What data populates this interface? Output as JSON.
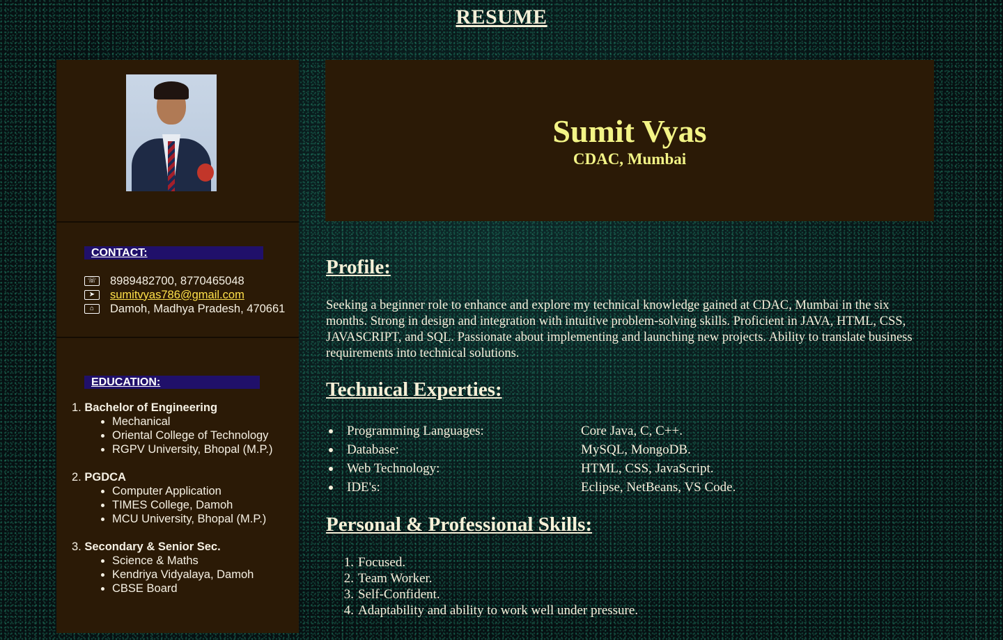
{
  "page_title": "RESUME",
  "header": {
    "name": "Sumit Vyas",
    "subtitle": "CDAC, Mumbai"
  },
  "contact": {
    "heading": "CONTACT:",
    "items": [
      {
        "icon": "phone-icon",
        "text": "8989482700, 8770465048"
      },
      {
        "icon": "email-icon",
        "text": "sumitvyas786@gmail.com"
      },
      {
        "icon": "home-icon",
        "text": "Damoh, Madhya Pradesh, 470661"
      }
    ]
  },
  "education": {
    "heading": "EDUCATION:",
    "items": [
      {
        "num": "1.",
        "title": "Bachelor of Engineering",
        "details": [
          "Mechanical",
          "Oriental College of Technology",
          "RGPV University, Bhopal (M.P.)"
        ]
      },
      {
        "num": "2.",
        "title": "PGDCA",
        "details": [
          "Computer Application",
          "TIMES College, Damoh",
          "MCU University, Bhopal (M.P.)"
        ]
      },
      {
        "num": "3.",
        "title": "Secondary & Senior Sec.",
        "details": [
          "Science & Maths",
          "Kendriya Vidyalaya, Damoh",
          "CBSE Board"
        ]
      }
    ]
  },
  "profile": {
    "heading": "Profile:",
    "text": "Seeking a beginner role to enhance and explore my technical knowledge gained at CDAC, Mumbai in the six months. Strong in design and integration with intuitive problem-solving skills. Proficient in JAVA, HTML, CSS, JAVASCRIPT, and SQL. Passionate about implementing and launching new projects. Ability to translate business requirements into technical solutions."
  },
  "technical": {
    "heading": "Technical Experties:",
    "items": [
      {
        "label": "Programming Languages:",
        "value": "Core Java, C, C++."
      },
      {
        "label": "Database:",
        "value": "MySQL, MongoDB."
      },
      {
        "label": "Web Technology:",
        "value": "HTML, CSS, JavaScript."
      },
      {
        "label": "IDE's:",
        "value": "Eclipse, NetBeans, VS Code."
      }
    ]
  },
  "skills": {
    "heading": "Personal & Professional Skills:",
    "items": [
      {
        "num": "1.",
        "text": "Focused."
      },
      {
        "num": "2.",
        "text": "Team Worker."
      },
      {
        "num": "3.",
        "text": "Self-Confident."
      },
      {
        "num": "4.",
        "text": "Adaptability and ability to work well under pressure."
      }
    ]
  }
}
